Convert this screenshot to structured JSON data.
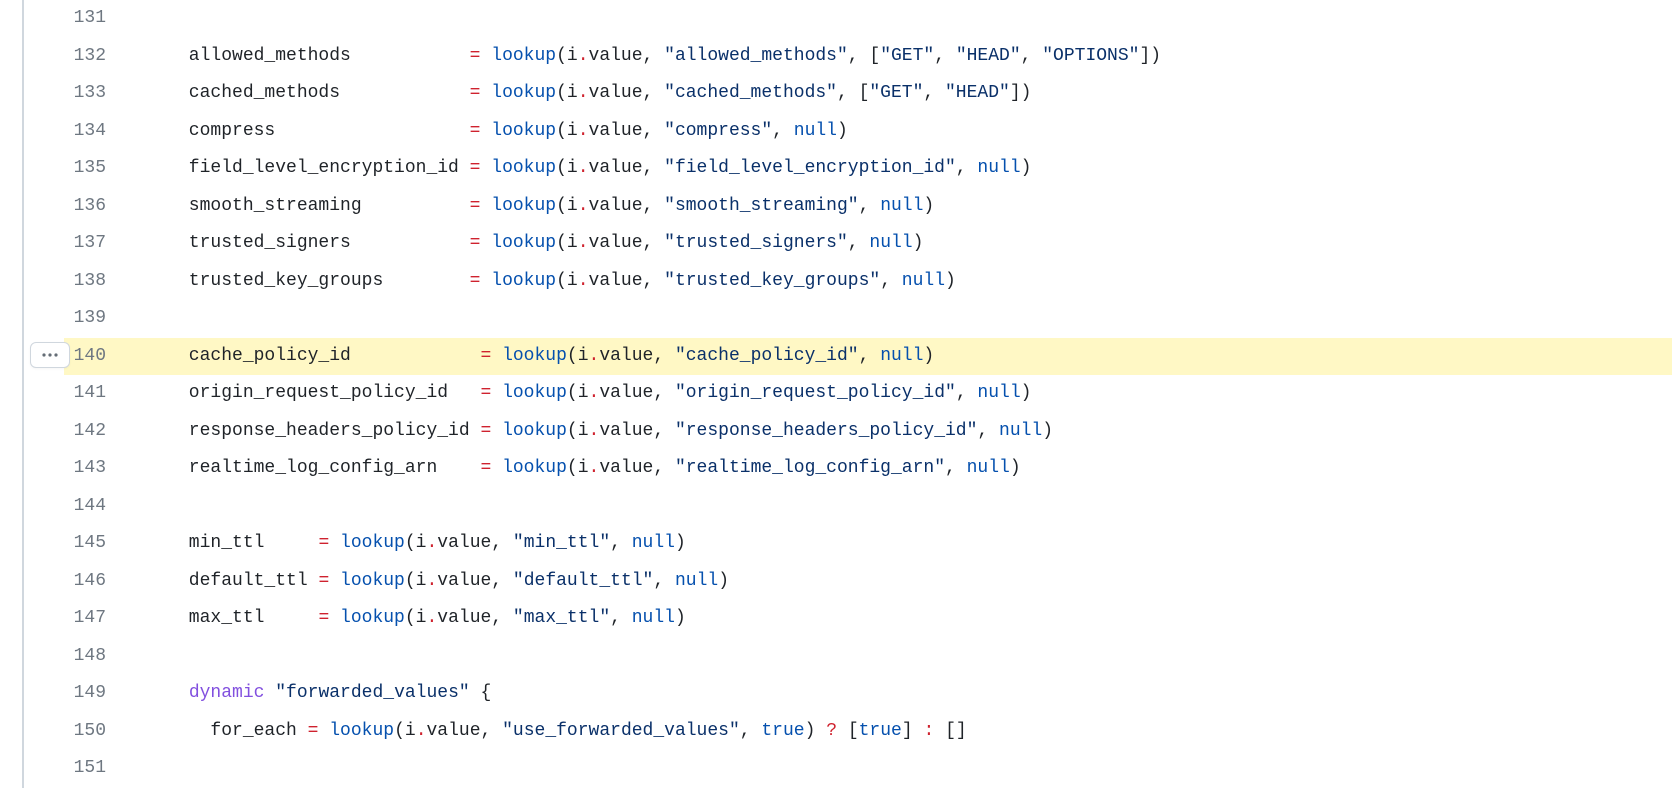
{
  "code_lines": [
    {
      "num": 131,
      "highlighted": false,
      "button": false,
      "tokens": []
    },
    {
      "num": 132,
      "highlighted": false,
      "button": false,
      "tokens": [
        {
          "cls": "tok-id",
          "t": "      allowed_methods           "
        },
        {
          "cls": "tok-op",
          "t": "="
        },
        {
          "cls": "tok-func",
          "t": " lookup"
        },
        {
          "cls": "tok-punc",
          "t": "(i"
        },
        {
          "cls": "tok-op",
          "t": "."
        },
        {
          "cls": "tok-punc",
          "t": "value, "
        },
        {
          "cls": "tok-str",
          "t": "\"allowed_methods\""
        },
        {
          "cls": "tok-punc",
          "t": ", ["
        },
        {
          "cls": "tok-str",
          "t": "\"GET\""
        },
        {
          "cls": "tok-punc",
          "t": ", "
        },
        {
          "cls": "tok-str",
          "t": "\"HEAD\""
        },
        {
          "cls": "tok-punc",
          "t": ", "
        },
        {
          "cls": "tok-str",
          "t": "\"OPTIONS\""
        },
        {
          "cls": "tok-punc",
          "t": "])"
        }
      ]
    },
    {
      "num": 133,
      "highlighted": false,
      "button": false,
      "tokens": [
        {
          "cls": "tok-id",
          "t": "      cached_methods            "
        },
        {
          "cls": "tok-op",
          "t": "="
        },
        {
          "cls": "tok-func",
          "t": " lookup"
        },
        {
          "cls": "tok-punc",
          "t": "(i"
        },
        {
          "cls": "tok-op",
          "t": "."
        },
        {
          "cls": "tok-punc",
          "t": "value, "
        },
        {
          "cls": "tok-str",
          "t": "\"cached_methods\""
        },
        {
          "cls": "tok-punc",
          "t": ", ["
        },
        {
          "cls": "tok-str",
          "t": "\"GET\""
        },
        {
          "cls": "tok-punc",
          "t": ", "
        },
        {
          "cls": "tok-str",
          "t": "\"HEAD\""
        },
        {
          "cls": "tok-punc",
          "t": "])"
        }
      ]
    },
    {
      "num": 134,
      "highlighted": false,
      "button": false,
      "tokens": [
        {
          "cls": "tok-id",
          "t": "      compress                  "
        },
        {
          "cls": "tok-op",
          "t": "="
        },
        {
          "cls": "tok-func",
          "t": " lookup"
        },
        {
          "cls": "tok-punc",
          "t": "(i"
        },
        {
          "cls": "tok-op",
          "t": "."
        },
        {
          "cls": "tok-punc",
          "t": "value, "
        },
        {
          "cls": "tok-str",
          "t": "\"compress\""
        },
        {
          "cls": "tok-punc",
          "t": ", "
        },
        {
          "cls": "tok-null",
          "t": "null"
        },
        {
          "cls": "tok-punc",
          "t": ")"
        }
      ]
    },
    {
      "num": 135,
      "highlighted": false,
      "button": false,
      "tokens": [
        {
          "cls": "tok-id",
          "t": "      field_level_encryption_id "
        },
        {
          "cls": "tok-op",
          "t": "="
        },
        {
          "cls": "tok-func",
          "t": " lookup"
        },
        {
          "cls": "tok-punc",
          "t": "(i"
        },
        {
          "cls": "tok-op",
          "t": "."
        },
        {
          "cls": "tok-punc",
          "t": "value, "
        },
        {
          "cls": "tok-str",
          "t": "\"field_level_encryption_id\""
        },
        {
          "cls": "tok-punc",
          "t": ", "
        },
        {
          "cls": "tok-null",
          "t": "null"
        },
        {
          "cls": "tok-punc",
          "t": ")"
        }
      ]
    },
    {
      "num": 136,
      "highlighted": false,
      "button": false,
      "tokens": [
        {
          "cls": "tok-id",
          "t": "      smooth_streaming          "
        },
        {
          "cls": "tok-op",
          "t": "="
        },
        {
          "cls": "tok-func",
          "t": " lookup"
        },
        {
          "cls": "tok-punc",
          "t": "(i"
        },
        {
          "cls": "tok-op",
          "t": "."
        },
        {
          "cls": "tok-punc",
          "t": "value, "
        },
        {
          "cls": "tok-str",
          "t": "\"smooth_streaming\""
        },
        {
          "cls": "tok-punc",
          "t": ", "
        },
        {
          "cls": "tok-null",
          "t": "null"
        },
        {
          "cls": "tok-punc",
          "t": ")"
        }
      ]
    },
    {
      "num": 137,
      "highlighted": false,
      "button": false,
      "tokens": [
        {
          "cls": "tok-id",
          "t": "      trusted_signers           "
        },
        {
          "cls": "tok-op",
          "t": "="
        },
        {
          "cls": "tok-func",
          "t": " lookup"
        },
        {
          "cls": "tok-punc",
          "t": "(i"
        },
        {
          "cls": "tok-op",
          "t": "."
        },
        {
          "cls": "tok-punc",
          "t": "value, "
        },
        {
          "cls": "tok-str",
          "t": "\"trusted_signers\""
        },
        {
          "cls": "tok-punc",
          "t": ", "
        },
        {
          "cls": "tok-null",
          "t": "null"
        },
        {
          "cls": "tok-punc",
          "t": ")"
        }
      ]
    },
    {
      "num": 138,
      "highlighted": false,
      "button": false,
      "tokens": [
        {
          "cls": "tok-id",
          "t": "      trusted_key_groups        "
        },
        {
          "cls": "tok-op",
          "t": "="
        },
        {
          "cls": "tok-func",
          "t": " lookup"
        },
        {
          "cls": "tok-punc",
          "t": "(i"
        },
        {
          "cls": "tok-op",
          "t": "."
        },
        {
          "cls": "tok-punc",
          "t": "value, "
        },
        {
          "cls": "tok-str",
          "t": "\"trusted_key_groups\""
        },
        {
          "cls": "tok-punc",
          "t": ", "
        },
        {
          "cls": "tok-null",
          "t": "null"
        },
        {
          "cls": "tok-punc",
          "t": ")"
        }
      ]
    },
    {
      "num": 139,
      "highlighted": false,
      "button": false,
      "tokens": []
    },
    {
      "num": 140,
      "highlighted": true,
      "button": true,
      "tokens": [
        {
          "cls": "tok-id",
          "t": "      cache_policy_id            "
        },
        {
          "cls": "tok-op",
          "t": "="
        },
        {
          "cls": "tok-func",
          "t": " lookup"
        },
        {
          "cls": "tok-punc",
          "t": "(i"
        },
        {
          "cls": "tok-op",
          "t": "."
        },
        {
          "cls": "tok-punc",
          "t": "value, "
        },
        {
          "cls": "tok-str",
          "t": "\"cache_policy_id\""
        },
        {
          "cls": "tok-punc",
          "t": ", "
        },
        {
          "cls": "tok-null",
          "t": "null"
        },
        {
          "cls": "tok-punc",
          "t": ")"
        }
      ]
    },
    {
      "num": 141,
      "highlighted": false,
      "button": false,
      "tokens": [
        {
          "cls": "tok-id",
          "t": "      origin_request_policy_id   "
        },
        {
          "cls": "tok-op",
          "t": "="
        },
        {
          "cls": "tok-func",
          "t": " lookup"
        },
        {
          "cls": "tok-punc",
          "t": "(i"
        },
        {
          "cls": "tok-op",
          "t": "."
        },
        {
          "cls": "tok-punc",
          "t": "value, "
        },
        {
          "cls": "tok-str",
          "t": "\"origin_request_policy_id\""
        },
        {
          "cls": "tok-punc",
          "t": ", "
        },
        {
          "cls": "tok-null",
          "t": "null"
        },
        {
          "cls": "tok-punc",
          "t": ")"
        }
      ]
    },
    {
      "num": 142,
      "highlighted": false,
      "button": false,
      "tokens": [
        {
          "cls": "tok-id",
          "t": "      response_headers_policy_id "
        },
        {
          "cls": "tok-op",
          "t": "="
        },
        {
          "cls": "tok-func",
          "t": " lookup"
        },
        {
          "cls": "tok-punc",
          "t": "(i"
        },
        {
          "cls": "tok-op",
          "t": "."
        },
        {
          "cls": "tok-punc",
          "t": "value, "
        },
        {
          "cls": "tok-str",
          "t": "\"response_headers_policy_id\""
        },
        {
          "cls": "tok-punc",
          "t": ", "
        },
        {
          "cls": "tok-null",
          "t": "null"
        },
        {
          "cls": "tok-punc",
          "t": ")"
        }
      ]
    },
    {
      "num": 143,
      "highlighted": false,
      "button": false,
      "tokens": [
        {
          "cls": "tok-id",
          "t": "      realtime_log_config_arn    "
        },
        {
          "cls": "tok-op",
          "t": "="
        },
        {
          "cls": "tok-func",
          "t": " lookup"
        },
        {
          "cls": "tok-punc",
          "t": "(i"
        },
        {
          "cls": "tok-op",
          "t": "."
        },
        {
          "cls": "tok-punc",
          "t": "value, "
        },
        {
          "cls": "tok-str",
          "t": "\"realtime_log_config_arn\""
        },
        {
          "cls": "tok-punc",
          "t": ", "
        },
        {
          "cls": "tok-null",
          "t": "null"
        },
        {
          "cls": "tok-punc",
          "t": ")"
        }
      ]
    },
    {
      "num": 144,
      "highlighted": false,
      "button": false,
      "tokens": []
    },
    {
      "num": 145,
      "highlighted": false,
      "button": false,
      "tokens": [
        {
          "cls": "tok-id",
          "t": "      min_ttl     "
        },
        {
          "cls": "tok-op",
          "t": "="
        },
        {
          "cls": "tok-func",
          "t": " lookup"
        },
        {
          "cls": "tok-punc",
          "t": "(i"
        },
        {
          "cls": "tok-op",
          "t": "."
        },
        {
          "cls": "tok-punc",
          "t": "value, "
        },
        {
          "cls": "tok-str",
          "t": "\"min_ttl\""
        },
        {
          "cls": "tok-punc",
          "t": ", "
        },
        {
          "cls": "tok-null",
          "t": "null"
        },
        {
          "cls": "tok-punc",
          "t": ")"
        }
      ]
    },
    {
      "num": 146,
      "highlighted": false,
      "button": false,
      "tokens": [
        {
          "cls": "tok-id",
          "t": "      default_ttl "
        },
        {
          "cls": "tok-op",
          "t": "="
        },
        {
          "cls": "tok-func",
          "t": " lookup"
        },
        {
          "cls": "tok-punc",
          "t": "(i"
        },
        {
          "cls": "tok-op",
          "t": "."
        },
        {
          "cls": "tok-punc",
          "t": "value, "
        },
        {
          "cls": "tok-str",
          "t": "\"default_ttl\""
        },
        {
          "cls": "tok-punc",
          "t": ", "
        },
        {
          "cls": "tok-null",
          "t": "null"
        },
        {
          "cls": "tok-punc",
          "t": ")"
        }
      ]
    },
    {
      "num": 147,
      "highlighted": false,
      "button": false,
      "tokens": [
        {
          "cls": "tok-id",
          "t": "      max_ttl     "
        },
        {
          "cls": "tok-op",
          "t": "="
        },
        {
          "cls": "tok-func",
          "t": " lookup"
        },
        {
          "cls": "tok-punc",
          "t": "(i"
        },
        {
          "cls": "tok-op",
          "t": "."
        },
        {
          "cls": "tok-punc",
          "t": "value, "
        },
        {
          "cls": "tok-str",
          "t": "\"max_ttl\""
        },
        {
          "cls": "tok-punc",
          "t": ", "
        },
        {
          "cls": "tok-null",
          "t": "null"
        },
        {
          "cls": "tok-punc",
          "t": ")"
        }
      ]
    },
    {
      "num": 148,
      "highlighted": false,
      "button": false,
      "tokens": []
    },
    {
      "num": 149,
      "highlighted": false,
      "button": false,
      "tokens": [
        {
          "cls": "tok-id",
          "t": "      "
        },
        {
          "cls": "tok-dyn",
          "t": "dynamic"
        },
        {
          "cls": "tok-id",
          "t": " "
        },
        {
          "cls": "tok-str",
          "t": "\"forwarded_values\""
        },
        {
          "cls": "tok-id",
          "t": " {"
        }
      ]
    },
    {
      "num": 150,
      "highlighted": false,
      "button": false,
      "tokens": [
        {
          "cls": "tok-id",
          "t": "        for_each "
        },
        {
          "cls": "tok-op",
          "t": "="
        },
        {
          "cls": "tok-func",
          "t": " lookup"
        },
        {
          "cls": "tok-punc",
          "t": "(i"
        },
        {
          "cls": "tok-op",
          "t": "."
        },
        {
          "cls": "tok-punc",
          "t": "value, "
        },
        {
          "cls": "tok-str",
          "t": "\"use_forwarded_values\""
        },
        {
          "cls": "tok-punc",
          "t": ", "
        },
        {
          "cls": "tok-bool",
          "t": "true"
        },
        {
          "cls": "tok-punc",
          "t": ") "
        },
        {
          "cls": "tok-op",
          "t": "?"
        },
        {
          "cls": "tok-punc",
          "t": " ["
        },
        {
          "cls": "tok-bool",
          "t": "true"
        },
        {
          "cls": "tok-punc",
          "t": "] "
        },
        {
          "cls": "tok-op",
          "t": ":"
        },
        {
          "cls": "tok-punc",
          "t": " []"
        }
      ]
    },
    {
      "num": 151,
      "highlighted": false,
      "button": false,
      "tokens": []
    }
  ]
}
